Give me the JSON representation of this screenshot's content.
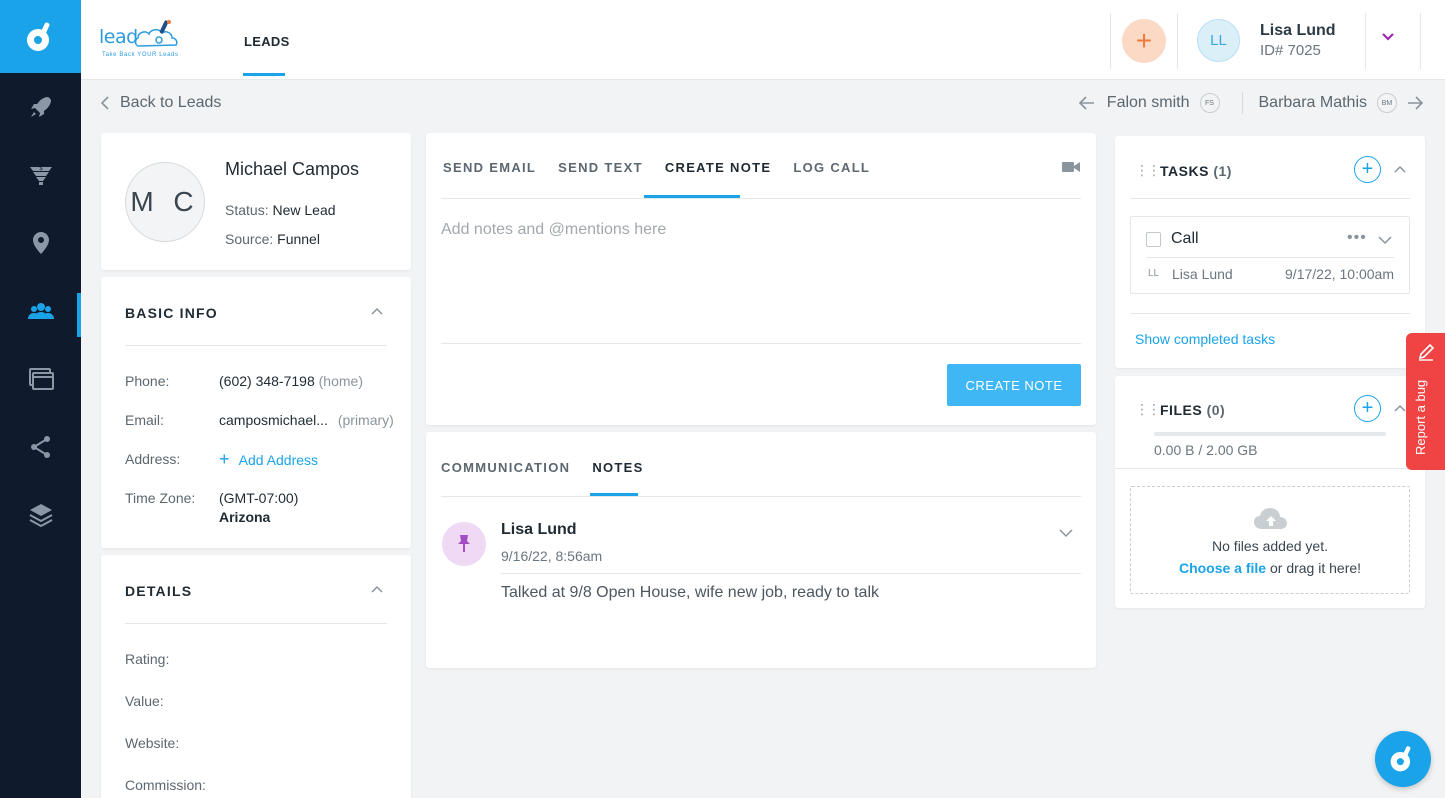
{
  "colors": {
    "accent": "#1aa3e8",
    "sidebar": "#0f1b2d",
    "primary_button": "#3fb7f5",
    "plus_button": "#fbd9c5",
    "report_bug": "#f04444"
  },
  "sidebar": {
    "items": [
      {
        "icon": "rocket-icon"
      },
      {
        "icon": "funnel-icon"
      },
      {
        "icon": "location-pin-icon"
      },
      {
        "icon": "users-icon",
        "active": true
      },
      {
        "icon": "windows-icon"
      },
      {
        "icon": "network-icon"
      },
      {
        "icon": "layers-icon"
      }
    ]
  },
  "header": {
    "brand": {
      "word": "lead",
      "tagline": "Take Back YOUR Leads"
    },
    "nav_leads": "LEADS",
    "user": {
      "initials": "LL",
      "name": "Lisa Lund",
      "id": "ID# 7025"
    },
    "add_label": "+"
  },
  "subheader": {
    "back": "Back to Leads",
    "prev_name": "Falon smith",
    "prev_initials": "FS",
    "next_name": "Barbara Mathis",
    "next_initials": "BM"
  },
  "profile": {
    "initials": "M C",
    "name": "Michael Campos",
    "status_label": "Status:",
    "status_value": "New Lead",
    "source_label": "Source:",
    "source_value": "Funnel"
  },
  "basic_info": {
    "title": "BASIC INFO",
    "phone_label": "Phone:",
    "phone_value": "(602) 348-7198",
    "phone_type": "(home)",
    "email_label": "Email:",
    "email_value": "camposmichael...",
    "email_type": "(primary)",
    "address_label": "Address:",
    "add_address": "Add Address",
    "timezone_label": "Time Zone:",
    "timezone_value": "(GMT-07:00)",
    "timezone_region": "Arizona"
  },
  "details": {
    "title": "DETAILS",
    "rating_label": "Rating:",
    "value_label": "Value:",
    "website_label": "Website:",
    "commission_label": "Commission:"
  },
  "composer": {
    "tabs": [
      "SEND EMAIL",
      "SEND TEXT",
      "CREATE NOTE",
      "LOG CALL"
    ],
    "active_tab": "CREATE NOTE",
    "placeholder": "Add notes and @mentions here",
    "submit": "CREATE NOTE"
  },
  "feed": {
    "tabs": [
      "COMMUNICATION",
      "NOTES"
    ],
    "active_tab": "NOTES",
    "note": {
      "author": "Lisa Lund",
      "date": "9/16/22, 8:56am",
      "text": "Talked at 9/8 Open House, wife new job, ready to talk"
    }
  },
  "tasks": {
    "title": "TASKS",
    "count": "(1)",
    "item": {
      "name": "Call",
      "dots": "•••",
      "assignee_initials": "LL",
      "assignee": "Lisa Lund",
      "due": "9/17/22, 10:00am"
    },
    "show_completed": "Show completed tasks"
  },
  "files": {
    "title": "FILES",
    "count": "(0)",
    "storage": "0.00 B / 2.00 GB",
    "storage_used_fraction": 0,
    "empty": "No files added yet.",
    "choose": "Choose a file",
    "drag": " or drag it here!"
  },
  "report_bug": "Report a bug"
}
